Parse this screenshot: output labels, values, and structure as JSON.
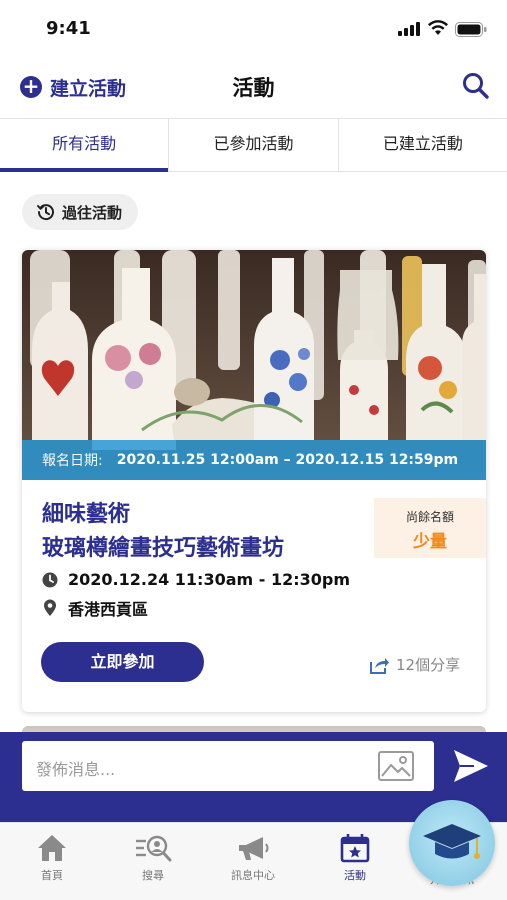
{
  "status_bar": {
    "time": "9:41"
  },
  "header": {
    "create_label": "建立活動",
    "title": "活動"
  },
  "tabs": [
    {
      "label": "所有活動",
      "active": true
    },
    {
      "label": "已參加活動",
      "active": false
    },
    {
      "label": "已建立活動",
      "active": false
    }
  ],
  "past_events_label": "過往活動",
  "event": {
    "registration_label": "報名日期:",
    "registration_dates": "2020.11.25 12:00am – 2020.12.15 12:59pm",
    "title_line1": "細味藝術",
    "title_line2": "玻璃樽繪畫技巧藝術畫坊",
    "quota_label": "尚餘名額",
    "quota_value": "少量",
    "datetime": "2020.12.24  11:30am - 12:30pm",
    "location": "香港西貢區",
    "join_label": "立即參加",
    "share_label": "12個分享"
  },
  "compose": {
    "placeholder": "發佈消息..."
  },
  "bottom_nav": [
    {
      "label": "首頁",
      "icon": "home-icon"
    },
    {
      "label": "搜尋",
      "icon": "search-people-icon"
    },
    {
      "label": "訊息中心",
      "icon": "megaphone-icon"
    },
    {
      "label": "活動",
      "icon": "calendar-star-icon",
      "active": true
    },
    {
      "label": "升學資訊",
      "icon": "graduation-cap-icon"
    }
  ],
  "colors": {
    "primary": "#2c2f8f",
    "registration_bar": "#2896d2",
    "quota_bg": "#fdf0e4",
    "quota_text": "#f08a1c"
  }
}
